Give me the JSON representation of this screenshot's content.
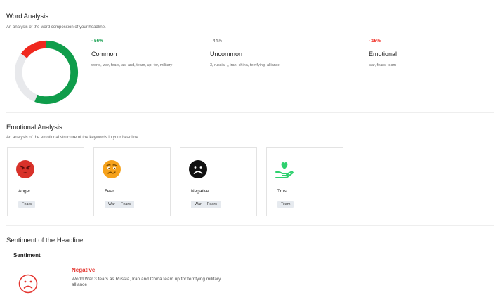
{
  "word_analysis": {
    "title": "Word Analysis",
    "subtitle": "An analysis of the word composition of your headline.",
    "donut": [
      {
        "name": "Common",
        "percent": 56,
        "color": "#0f9d4b"
      },
      {
        "name": "Uncommon",
        "percent": 44,
        "color": "#e8e9ec"
      },
      {
        "name": "Emotional",
        "percent": 15,
        "color": "#f0281e"
      }
    ],
    "stats": [
      {
        "pct": "- 56%",
        "name": "Common",
        "words": "world, war, fears, as, and, team, up, for, military",
        "color": "#0f9d4b"
      },
      {
        "pct": "- 44%",
        "name": "Uncommon",
        "words": "3, russia, ,, iran, china, terrifying, alliance",
        "color": "#555555"
      },
      {
        "pct": "- 15%",
        "name": "Emotional",
        "words": "war, fears, team",
        "color": "#f0281e"
      }
    ]
  },
  "emotional_analysis": {
    "title": "Emotional Analysis",
    "subtitle": "An analysis of the emotional structure of the keywords in your headline.",
    "cards": [
      {
        "label": "Anger",
        "icon": "angry-face-icon",
        "color": "#d8322a",
        "tags": [
          "Fears"
        ]
      },
      {
        "label": "Fear",
        "icon": "fearful-face-icon",
        "color": "#f6a21b",
        "tags": [
          "War",
          "Fears"
        ]
      },
      {
        "label": "Negative",
        "icon": "sad-face-icon",
        "color": "#111111",
        "tags": [
          "War",
          "Fears"
        ]
      },
      {
        "label": "Trust",
        "icon": "heart-hand-icon",
        "color": "#2ed06e",
        "tags": [
          "Team"
        ]
      }
    ]
  },
  "sentiment": {
    "title": "Sentiment of the Headline",
    "label": "Sentiment",
    "value": "Negative",
    "value_color": "#e4352f",
    "icon": "frown-face-icon",
    "headline": "World War 3 fears as Russia, Iran and China team up for terrifying military alliance"
  }
}
